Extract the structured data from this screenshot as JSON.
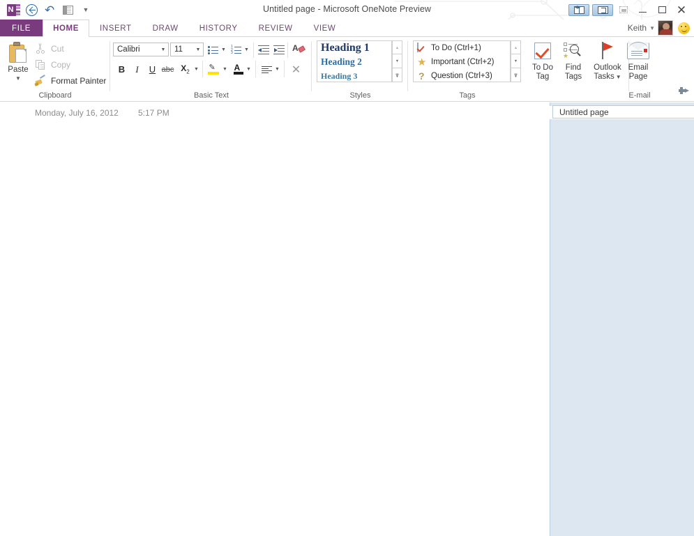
{
  "window": {
    "title": "Untitled page - Microsoft OneNote Preview",
    "minimize_label": "Minimize",
    "maximize_label": "Restore Down",
    "close_label": "Close"
  },
  "quick_access": {
    "app_icon": "onenote-logo-icon",
    "items": [
      {
        "name": "back-icon",
        "label": "Back"
      },
      {
        "name": "undo-icon",
        "label": "Undo"
      },
      {
        "name": "dock-to-desktop-icon",
        "label": "Dock to Desktop"
      },
      {
        "name": "customize-qat-caret-icon",
        "label": "Customize Quick Access Toolbar"
      }
    ]
  },
  "titlebar_right": {
    "toggles": [
      {
        "name": "full-page-view-toggle",
        "label": "Full Page View"
      },
      {
        "name": "dock-to-desktop-toggle",
        "label": "Dock to Desktop"
      }
    ],
    "ribbon_display_label": "Ribbon Display Options"
  },
  "tabs": {
    "file_label": "FILE",
    "items": [
      {
        "label": "HOME",
        "active": true
      },
      {
        "label": "INSERT",
        "active": false
      },
      {
        "label": "DRAW",
        "active": false
      },
      {
        "label": "HISTORY",
        "active": false
      },
      {
        "label": "REVIEW",
        "active": false
      },
      {
        "label": "VIEW",
        "active": false
      }
    ],
    "user": "Keith"
  },
  "ribbon": {
    "clipboard": {
      "group_label": "Clipboard",
      "paste_label": "Paste",
      "commands": [
        {
          "label": "Cut",
          "icon": "scissors-icon",
          "enabled": false
        },
        {
          "label": "Copy",
          "icon": "copy-icon",
          "enabled": false
        },
        {
          "label": "Format Painter",
          "icon": "format-painter-icon",
          "enabled": true
        }
      ]
    },
    "basic_text": {
      "group_label": "Basic Text",
      "font_name": "Calibri",
      "font_size": "11",
      "buttons": [
        {
          "name": "bullets-button",
          "label": "Bullets"
        },
        {
          "name": "numbering-button",
          "label": "Numbering"
        },
        {
          "name": "decrease-indent-button",
          "label": "Decrease Indent"
        },
        {
          "name": "increase-indent-button",
          "label": "Increase Indent"
        },
        {
          "name": "clear-formatting-button",
          "label": "Clear Formatting"
        },
        {
          "name": "bold-button",
          "label": "B"
        },
        {
          "name": "italic-button",
          "label": "I"
        },
        {
          "name": "underline-button",
          "label": "U"
        },
        {
          "name": "strikethrough-button",
          "label": "abc"
        },
        {
          "name": "subscript-button",
          "label": "X"
        },
        {
          "name": "highlight-button",
          "label": "Text Highlight Color"
        },
        {
          "name": "font-color-button",
          "label": "Font Color"
        },
        {
          "name": "align-button",
          "label": "Paragraph Alignment"
        },
        {
          "name": "remove-style-button",
          "label": "Remove Style"
        }
      ]
    },
    "styles": {
      "group_label": "Styles",
      "items": [
        {
          "label": "Heading 1"
        },
        {
          "label": "Heading 2"
        },
        {
          "label": "Heading 3"
        }
      ],
      "scroll_up": "Scroll Up",
      "scroll_down": "Scroll Down",
      "more": "More Styles"
    },
    "tags": {
      "group_label": "Tags",
      "items": [
        {
          "label": "To Do (Ctrl+1)",
          "icon": "todo-checkbox-icon"
        },
        {
          "label": "Important (Ctrl+2)",
          "icon": "star-icon"
        },
        {
          "label": "Question (Ctrl+3)",
          "icon": "question-mark-icon"
        }
      ],
      "scroll_up": "Scroll Up",
      "scroll_down": "Scroll Down",
      "more": "More Tags"
    },
    "tag_buttons": [
      {
        "name": "to-do-tag-button",
        "line1": "To Do",
        "line2": "Tag",
        "icon": "checkmark-box-icon"
      },
      {
        "name": "find-tags-button",
        "line1": "Find",
        "line2": "Tags",
        "icon": "find-tags-icon"
      },
      {
        "name": "outlook-tasks-button",
        "line1": "Outlook",
        "line2": "Tasks",
        "icon": "red-flag-icon",
        "has_caret": true
      }
    ],
    "email": {
      "group_label": "E-mail",
      "line1": "Email",
      "line2": "Page",
      "icon": "envelope-icon"
    },
    "pin_label": "Pin the ribbon"
  },
  "page": {
    "date": "Monday, July 16, 2012",
    "time": "5:17 PM"
  },
  "sidebar": {
    "page_tabs": [
      {
        "label": "Untitled page",
        "selected": true
      }
    ]
  },
  "colors": {
    "accent_purple": "#7a3b7e",
    "tag_red": "#d94f2b",
    "sidebar_blue": "#dde7f2",
    "heading1": "#1f3864",
    "heading2": "#2e6da4",
    "heading3": "#3d7a9e"
  }
}
